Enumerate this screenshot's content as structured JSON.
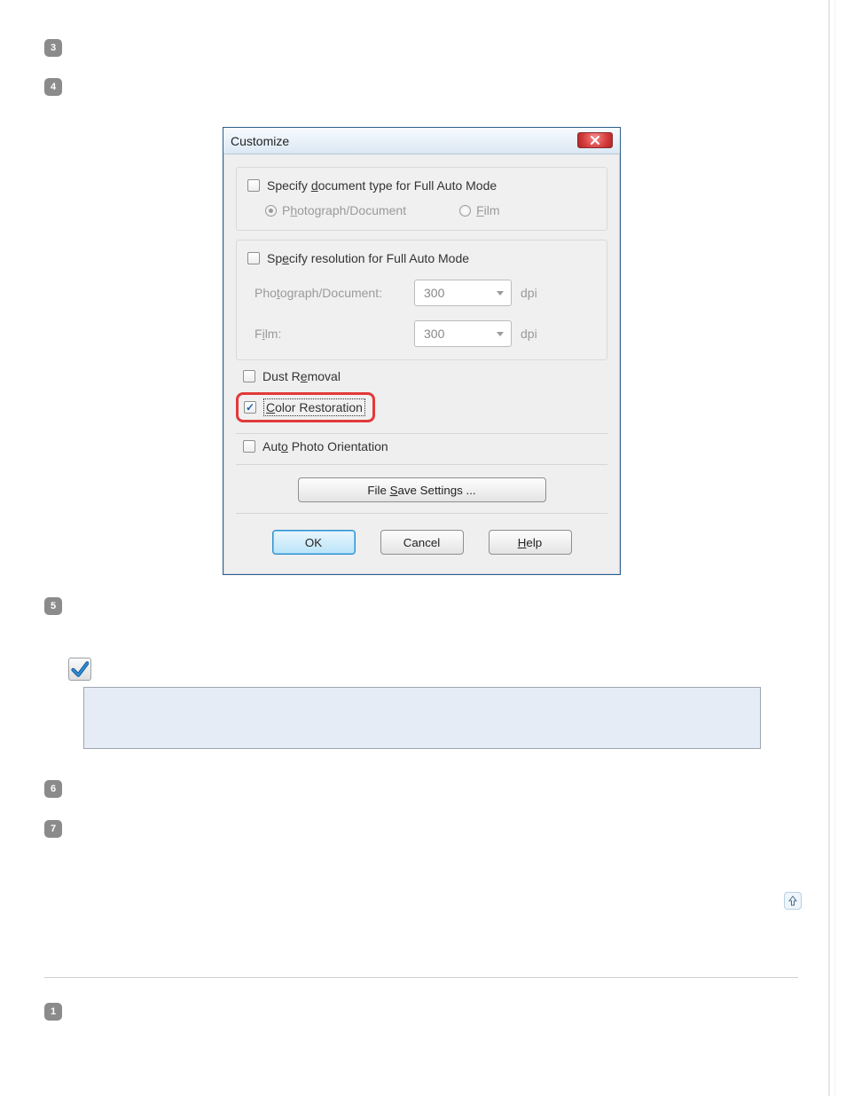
{
  "steps": {
    "s3": "3",
    "s4": "4",
    "s5": "5",
    "s6": "6",
    "s7": "7",
    "s1": "1"
  },
  "dialog": {
    "title": "Customize",
    "doc_type": {
      "checkbox_label_pre": "Specify ",
      "checkbox_label_u": "d",
      "checkbox_label_post": "ocument type for Full Auto Mode",
      "radio_photo_pre": "P",
      "radio_photo_u": "h",
      "radio_photo_post": "otograph/Document",
      "radio_film_u": "F",
      "radio_film_post": "ilm"
    },
    "resolution": {
      "checkbox_label_pre": "Sp",
      "checkbox_label_u": "e",
      "checkbox_label_post": "cify resolution for Full Auto Mode",
      "photo_label_pre": "Pho",
      "photo_label_u": "t",
      "photo_label_post": "ograph/Document:",
      "photo_value": "300",
      "photo_unit": "dpi",
      "film_label_pre": "F",
      "film_label_u": "i",
      "film_label_post": "lm:",
      "film_value": "300",
      "film_unit": "dpi"
    },
    "dust_pre": "Dust R",
    "dust_u": "e",
    "dust_post": "moval",
    "color_u": "C",
    "color_post": "olor Restoration",
    "auto_pre": "Aut",
    "auto_u": "o",
    "auto_post": " Photo Orientation",
    "file_save_pre": "File ",
    "file_save_u": "S",
    "file_save_post": "ave Settings ...",
    "ok": "OK",
    "cancel": "Cancel",
    "help_u": "H",
    "help_post": "elp"
  }
}
